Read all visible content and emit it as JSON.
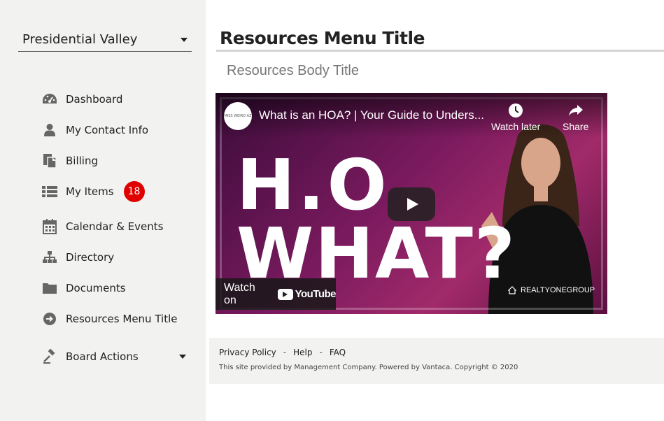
{
  "sidebar": {
    "community_selector": {
      "value": "Presidential Valley"
    },
    "nav_items": [
      {
        "label": "Dashboard",
        "icon": "dashboard-icon"
      },
      {
        "label": "My Contact Info",
        "icon": "user-icon"
      },
      {
        "label": "Billing",
        "icon": "billing-icon"
      },
      {
        "label": "My Items",
        "icon": "list-icon",
        "badge": "18"
      },
      {
        "label": "Calendar & Events",
        "icon": "calendar-icon"
      },
      {
        "label": "Directory",
        "icon": "sitemap-icon"
      },
      {
        "label": "Documents",
        "icon": "folder-icon"
      },
      {
        "label": "Resources Menu Title",
        "icon": "arrow-circle-right-icon"
      },
      {
        "label": "Board Actions",
        "icon": "gavel-icon"
      }
    ]
  },
  "main": {
    "title": "Resources Menu Title",
    "body_title": "Resources Body Title",
    "video": {
      "title": "What is an HOA? | Your Guide to Unders...",
      "watch_later_label": "Watch later",
      "share_label": "Share",
      "thumbnail_line1": "H.O",
      "thumbnail_line2": "WHAT?",
      "watch_on_label": "Watch on",
      "youtube_word": "YouTube",
      "brand_mark": "REALTYONEGROUP",
      "channel_logo_text": "MISS WEIRD AZ"
    }
  },
  "footer": {
    "links": [
      "Privacy Policy",
      "Help",
      "FAQ"
    ],
    "separator": "-",
    "copyright": "This site provided by Management Company. Powered by Vantaca. Copyright © 2020"
  },
  "colors": {
    "sidebar_bg": "#f2f2f0",
    "badge": "#e00000",
    "icon_gray": "#666666"
  }
}
